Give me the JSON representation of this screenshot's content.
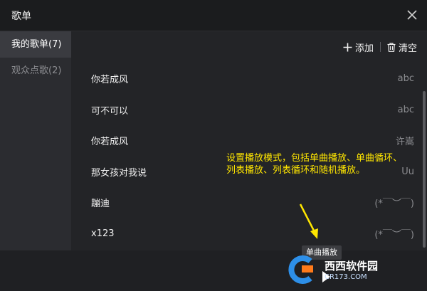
{
  "window": {
    "title": "歌单"
  },
  "sidebar": {
    "items": [
      {
        "label": "我的歌单(7)",
        "active": true
      },
      {
        "label": "观众点歌(2)",
        "active": false
      }
    ]
  },
  "toolbar": {
    "add_label": "添加",
    "clear_label": "清空"
  },
  "songs": [
    {
      "title": "你若成风",
      "artist": "abc"
    },
    {
      "title": "可不可以",
      "artist": "abc"
    },
    {
      "title": "你若成风",
      "artist": "许嵩"
    },
    {
      "title": "那女孩对我说",
      "artist": "Uu"
    },
    {
      "title": "蹦迪",
      "artist": "(*￣︶￣)"
    },
    {
      "title": "x123",
      "artist": "(*￣︶￣)"
    }
  ],
  "annotation": {
    "line1": "设置播放模式，包括单曲播放、单曲循环、",
    "line2": "列表播放、列表循环和随机播放。"
  },
  "tooltip": {
    "text": "单曲播放"
  },
  "watermark": {
    "logo": "西西软件园",
    "url": "CR173.COM"
  },
  "colors": {
    "annotation": "#ffe600",
    "background": "#1f2023",
    "sidebar_active": "#3a3b40"
  }
}
